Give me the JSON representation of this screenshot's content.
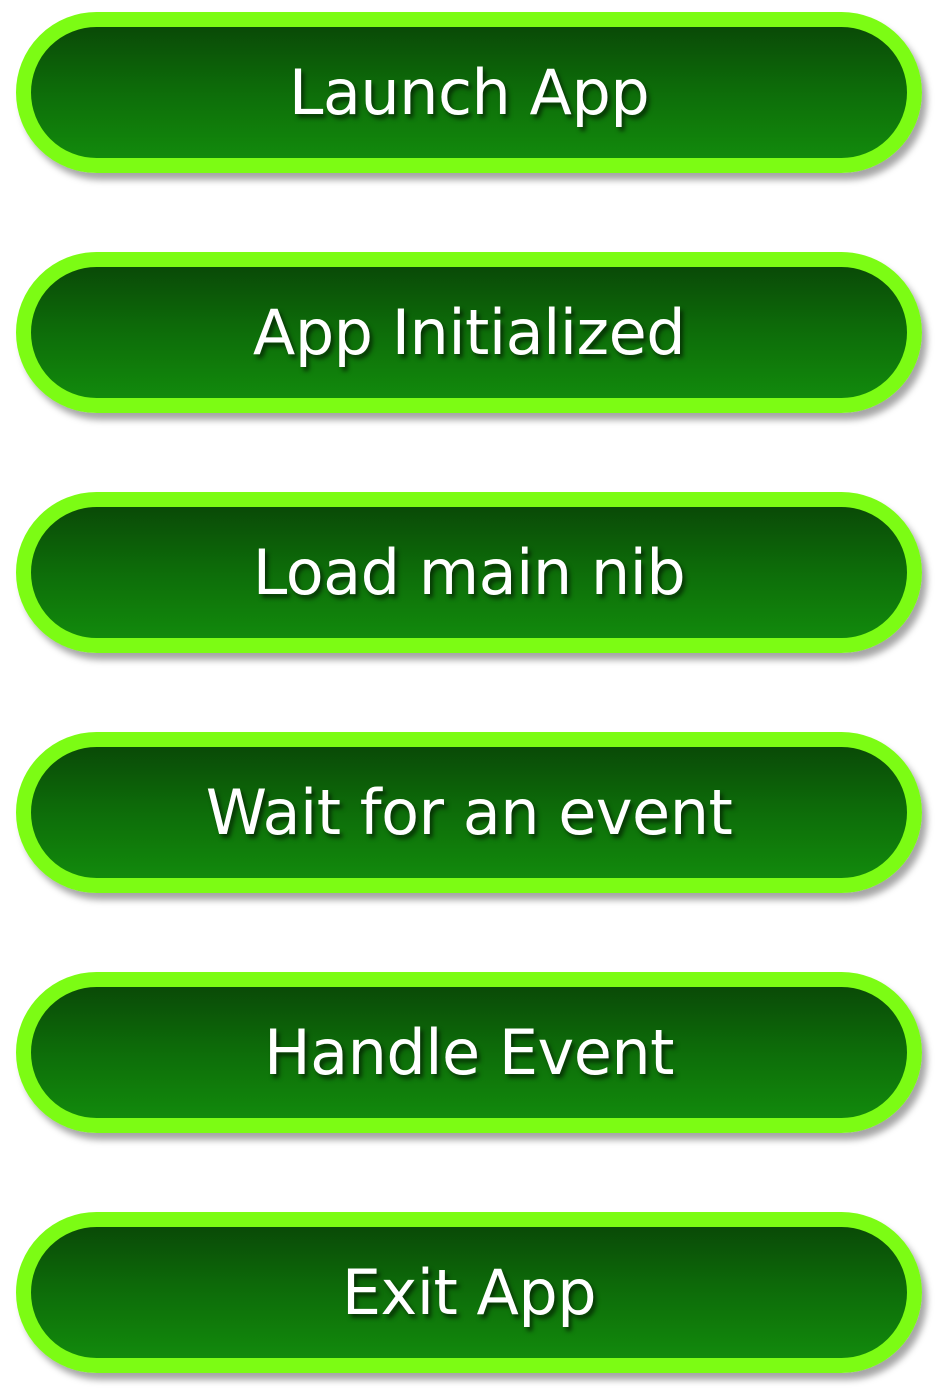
{
  "steps": [
    {
      "label": "Launch App"
    },
    {
      "label": "App Initialized"
    },
    {
      "label": "Load main nib"
    },
    {
      "label": "Wait for an event"
    },
    {
      "label": "Handle Event"
    },
    {
      "label": "Exit App"
    }
  ],
  "colors": {
    "border": "#7cfc14",
    "fill_top": "#0a4a07",
    "fill_bottom": "#128a0c",
    "text": "#ffffff"
  }
}
